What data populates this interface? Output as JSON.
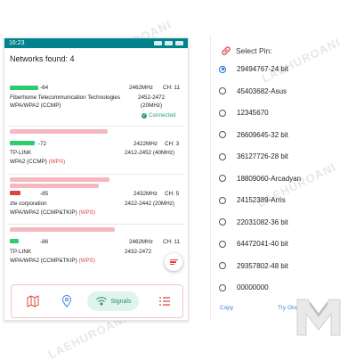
{
  "status": {
    "time": "16:23"
  },
  "networks_title": "Networks found: 4",
  "networks": [
    {
      "signal": "-64",
      "freq": "2462MHz",
      "ch": "CH: 11",
      "name": "Fiberhome Telecommunication Technologies",
      "range": "2452-2472",
      "width": "(20MHz)",
      "security": "WPA/WPA2 (CCMP)",
      "wps": "",
      "status": "Connected",
      "signal_color": "#2ecc71"
    },
    {
      "signal": "-72",
      "freq": "2422MHz",
      "ch": "CH: 3",
      "name": "TP-LINK",
      "range": "2412-2452 (40MHz)",
      "width": "",
      "security": "WPA2 (CCMP)",
      "wps": "(WPS)",
      "status": "",
      "signal_color": "#2ecc71"
    },
    {
      "signal": "-85",
      "freq": "2432MHz",
      "ch": "CH: 5",
      "name": "zte corporation",
      "range": "2422-2442 (20MHz)",
      "width": "",
      "security": "WPA/WPA2 (CCMP&TKIP)",
      "wps": "(WPS)",
      "status": "",
      "signal_color": "#e0453c"
    },
    {
      "signal": "-86",
      "freq": "2462MHz",
      "ch": "CH: 11",
      "name": "TP-LINK",
      "range": "2432-2472",
      "width": "",
      "security": "WPA/WPA2 (CCMP&TKIP)",
      "wps": "(WPS)",
      "status": "",
      "signal_color": "#2ecc71"
    }
  ],
  "nav": {
    "signals_label": "Signals"
  },
  "select_pin": {
    "title": "Select Pin:",
    "pins": [
      "29494767-24 bit",
      "45403682-Asus",
      "12345670",
      "26609645-32 bit",
      "36127726-28 bit",
      "18809060-Arcadyan",
      "24152389-Arris",
      "22031082-36 bit",
      "64472041-40 bit",
      "29357802-48 bit",
      "00000000"
    ],
    "selected_index": 0,
    "copy_label": "Copy",
    "try_label": "Try One"
  },
  "watermark": "LAEHUROANI",
  "colors": {
    "accent": "#00838f",
    "wps": "#e0453c",
    "connected": "#2aa36b",
    "radio": "#1f6fdc",
    "link": "#3b82d6"
  }
}
